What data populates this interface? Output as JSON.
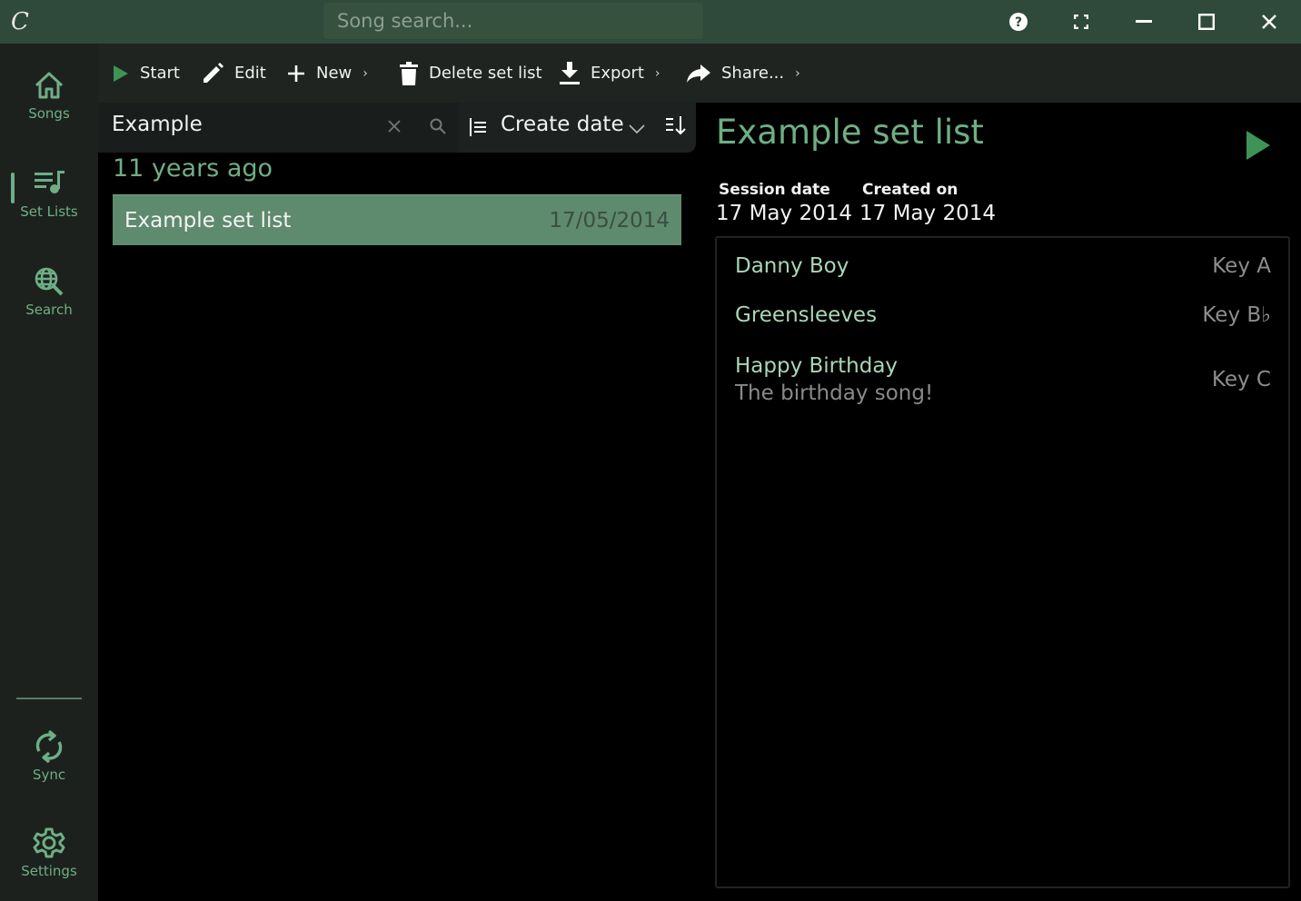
{
  "titlebar": {
    "logo": "C",
    "search_placeholder": "Song search...",
    "icons": [
      "help-icon",
      "fullscreen-icon",
      "minimize-icon",
      "maximize-icon",
      "close-icon"
    ]
  },
  "sidebar": {
    "items": [
      {
        "label": "Songs",
        "icon": "home-icon"
      },
      {
        "label": "Set Lists",
        "icon": "set-list-icon",
        "active": true
      },
      {
        "label": "Search",
        "icon": "search-globe-icon"
      },
      {
        "label": "Sync",
        "icon": "sync-icon"
      },
      {
        "label": "Settings",
        "icon": "gear-icon"
      }
    ]
  },
  "toolbar": {
    "start_label": "Start",
    "edit_label": "Edit",
    "new_label": "New",
    "delete_label": "Delete set list",
    "export_label": "Export",
    "share_label": "Share...",
    "chevron": "›"
  },
  "filter": {
    "value": "Example",
    "sort_label": "Create date"
  },
  "list": {
    "group_header": "11 years ago",
    "items": [
      {
        "title": "Example set list",
        "date": "17/05/2014",
        "selected": true
      }
    ]
  },
  "detail": {
    "title": "Example set list",
    "session_date_label": "Session date",
    "session_date": "17 May 2014",
    "created_on_label": "Created on",
    "created_on": "17 May 2014",
    "songs": [
      {
        "title": "Danny Boy",
        "subtitle": "",
        "key": "Key A"
      },
      {
        "title": "Greensleeves",
        "subtitle": "",
        "key": "Key B♭"
      },
      {
        "title": "Happy Birthday",
        "subtitle": "The birthday song!",
        "key": "Key C"
      }
    ]
  },
  "colors": {
    "accent": "#6fae85",
    "titlebar": "#2f4a3a",
    "selection": "#5e8a6d",
    "play": "#3f9455"
  }
}
